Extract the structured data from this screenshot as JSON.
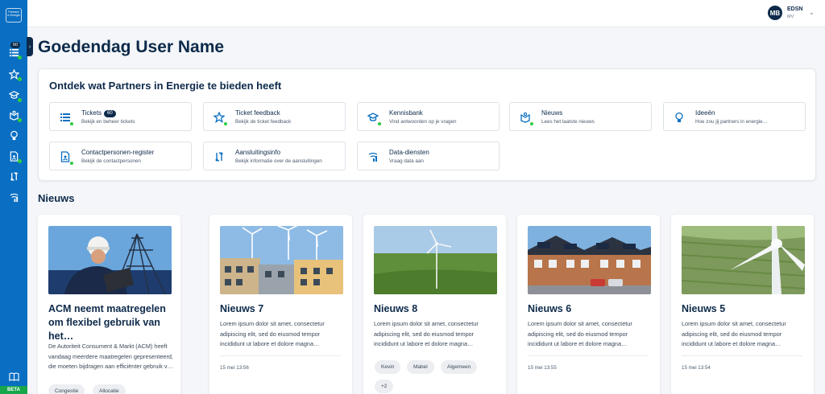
{
  "app": {
    "logo_text": "Partners in Energie",
    "beta_label": "BETA"
  },
  "sidebar": {
    "tickets_badge": "60",
    "items": [
      {
        "icon": "list-icon",
        "active_dot": true
      },
      {
        "icon": "star-feedback-icon",
        "active_dot": true
      },
      {
        "icon": "graduation-cap-icon",
        "active_dot": true
      },
      {
        "icon": "news-icon",
        "active_dot": true
      },
      {
        "icon": "lightbulb-icon",
        "active_dot": false
      },
      {
        "icon": "contact-register-icon",
        "active_dot": true
      },
      {
        "icon": "connection-icon",
        "active_dot": false
      },
      {
        "icon": "data-signal-icon",
        "active_dot": false
      },
      {
        "icon": "book-icon",
        "active_dot": false
      }
    ]
  },
  "header": {
    "avatar_initials": "MB",
    "organization": "EDSN",
    "role": "MV"
  },
  "greeting": "Goedendag User Name",
  "discover": {
    "title": "Ontdek wat Partners in Energie te bieden heeft",
    "tiles": [
      {
        "title": "Tickets",
        "badge": "60",
        "subtitle": "Bekijk en beheer tickets"
      },
      {
        "title": "Ticket feedback",
        "subtitle": "Bekijk de ticket feedback"
      },
      {
        "title": "Kennisbank",
        "subtitle": "Vind antwoorden op je vragen"
      },
      {
        "title": "Nieuws",
        "subtitle": "Lees het laatste nieuws"
      },
      {
        "title": "Ideeën",
        "subtitle": "Hoe zou jij partners in energie…"
      },
      {
        "title": "Contactpersonen-register",
        "subtitle": "Bekijk de contactpersonen"
      },
      {
        "title": "Aansluitingsinfo",
        "subtitle": "Bekijk informatie over de aansluitingen"
      },
      {
        "title": "Data-diensten",
        "subtitle": "Vraag data aan"
      }
    ]
  },
  "news": {
    "heading": "Nieuws",
    "cards": [
      {
        "title": "ACM neemt maatregelen om flexibel gebruik van het…",
        "body": "De Autoriteit Consument & Markt (ACM) heeft vandaag meerdere maatregelen gepresenteerd, die moeten bijdragen aan efficiënter gebruik v…",
        "tags": [
          "Congestie",
          "Allocatie"
        ]
      },
      {
        "title": "Nieuws 7",
        "body": "Lorem ipsum dolor sit amet, consectetur adipiscing elit, sed do eiusmod tempor incididunt ut labore et dolore magna…",
        "time": "15 mei 13:56"
      },
      {
        "title": "Nieuws 8",
        "body": "Lorem ipsum dolor sit amet, consectetur adipiscing elit, sed do eiusmod tempor incididunt ut labore et dolore magna…",
        "tags": [
          "Kevin",
          "Mabel",
          "Algemeen",
          "+2"
        ]
      },
      {
        "title": "Nieuws 6",
        "body": "Lorem ipsum dolor sit amet, consectetur adipiscing elit, sed do eiusmod tempor incididunt ut labore et dolore magna…",
        "time": "15 mei 13:55"
      },
      {
        "title": "Nieuws 5",
        "body": "Lorem ipsum dolor sit amet, consectetur adipiscing elit, sed do eiusmod tempor incididunt ut labore et dolore magna…",
        "time": "15 mei 13:54"
      }
    ]
  },
  "colors": {
    "sidebar": "#0a6fc2",
    "navy": "#0d2a4a",
    "status_green": "#2ecc40",
    "beta_green": "#17a64a"
  }
}
